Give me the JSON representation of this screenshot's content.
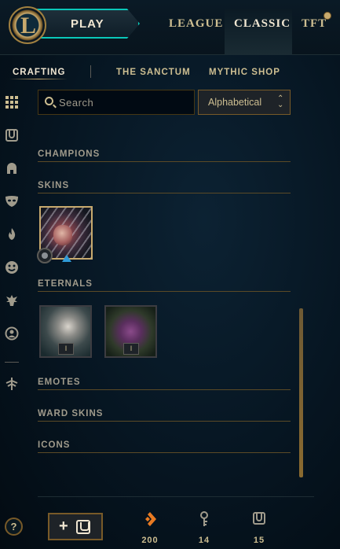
{
  "topbar": {
    "play_label": "PLAY",
    "nav": [
      "LEAGUE",
      "CLASSIC",
      "TFT"
    ],
    "active_nav": "CLASSIC"
  },
  "subnav": {
    "tabs": [
      "CRAFTING",
      "THE SANCTUM",
      "MYTHIC SHOP"
    ],
    "active": "CRAFTING"
  },
  "sidebar": {
    "icons": [
      "grid-icon",
      "chest-icon",
      "helmet-icon",
      "mask-icon",
      "flame-icon",
      "emote-face-icon",
      "ward-totem-icon",
      "profile-icon",
      "rune-icon"
    ]
  },
  "search": {
    "placeholder": "Search",
    "value": ""
  },
  "sort": {
    "selected": "Alphabetical"
  },
  "sections": {
    "champions": "CHAMPIONS",
    "skins": "SKINS",
    "eternals": "ETERNALS",
    "emotes": "EMOTES",
    "ward_skins": "WARD SKINS",
    "icons": "ICONS"
  },
  "eternals": [
    {
      "badge": "I"
    },
    {
      "badge": "I"
    }
  ],
  "footer": {
    "help_label": "?",
    "add_label": "+",
    "currencies": [
      {
        "icon": "orange-essence-icon",
        "value": "200",
        "color": "#e87a22"
      },
      {
        "icon": "key-icon",
        "value": "14",
        "color": "#a09b8c"
      },
      {
        "icon": "chest-icon",
        "value": "15",
        "color": "#a09b8c"
      }
    ]
  },
  "colors": {
    "gold": "#c8aa6e",
    "accent_teal": "#0ac8b9",
    "text": "#cdbe91"
  }
}
